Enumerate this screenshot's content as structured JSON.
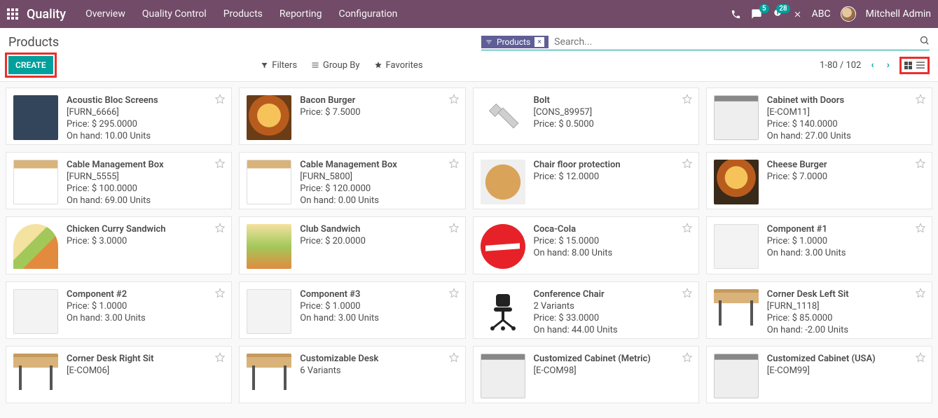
{
  "header": {
    "brand": "Quality",
    "nav": [
      "Overview",
      "Quality Control",
      "Products",
      "Reporting",
      "Configuration"
    ],
    "chat_badge": "5",
    "activity_badge": "28",
    "company": "ABC",
    "user": "Mitchell Admin"
  },
  "breadcrumb": "Products",
  "search": {
    "chip_label": "Products",
    "placeholder": "Search..."
  },
  "buttons": {
    "create": "CREATE"
  },
  "filters": {
    "filters": "Filters",
    "groupby": "Group By",
    "favorites": "Favorites"
  },
  "pager": {
    "range": "1-80 / 102"
  },
  "labels": {
    "price_prefix": "Price: $ ",
    "onhand_prefix": "On hand: ",
    "onhand_suffix": " Units",
    "variants_suffix": " Variants"
  },
  "products": [
    {
      "name": "Acoustic Bloc Screens",
      "ref": "[FURN_6666]",
      "price": "295.0000",
      "onhand": "10.00",
      "thumb": "t-screen"
    },
    {
      "name": "Bacon Burger",
      "price": "7.5000",
      "thumb": "t-burger"
    },
    {
      "name": "Bolt",
      "ref": "[CONS_89957]",
      "price": "0.5000",
      "thumb": "t-bolt"
    },
    {
      "name": "Cabinet with Doors",
      "ref": "[E-COM11]",
      "price": "140.0000",
      "onhand": "27.00",
      "thumb": "t-cabinet"
    },
    {
      "name": "Cable Management Box",
      "ref": "[FURN_5555]",
      "price": "100.0000",
      "onhand": "69.00",
      "thumb": "t-box"
    },
    {
      "name": "Cable Management Box",
      "ref": "[FURN_5800]",
      "price": "120.0000",
      "onhand": "0.00",
      "thumb": "t-box"
    },
    {
      "name": "Chair floor protection",
      "price": "12.0000",
      "thumb": "t-chairmat"
    },
    {
      "name": "Cheese Burger",
      "price": "7.0000",
      "thumb": "t-cheese"
    },
    {
      "name": "Chicken Curry Sandwich",
      "price": "3.0000",
      "thumb": "t-sandwich"
    },
    {
      "name": "Club Sandwich",
      "price": "20.0000",
      "thumb": "t-club"
    },
    {
      "name": "Coca-Cola",
      "price": "15.0000",
      "onhand": "8.00",
      "thumb": "t-coke"
    },
    {
      "name": "Component #1",
      "price": "1.0000",
      "onhand": "3.00",
      "thumb": "t-comp"
    },
    {
      "name": "Component #2",
      "price": "1.0000",
      "onhand": "3.00",
      "thumb": "t-comp"
    },
    {
      "name": "Component #3",
      "price": "1.0000",
      "onhand": "3.00",
      "thumb": "t-comp"
    },
    {
      "name": "Conference Chair",
      "variants": "2",
      "price": "33.0000",
      "onhand": "44.00",
      "thumb": "t-chair"
    },
    {
      "name": "Corner Desk Left Sit",
      "ref": "[FURN_1118]",
      "price": "85.0000",
      "onhand": "-2.00",
      "thumb": "t-desk"
    },
    {
      "name": "Corner Desk Right Sit",
      "ref": "[E-COM06]",
      "thumb": "t-desk"
    },
    {
      "name": "Customizable Desk",
      "variants": "6",
      "thumb": "t-desk"
    },
    {
      "name": "Customized Cabinet (Metric)",
      "ref": "[E-COM98]",
      "thumb": "t-cabinet"
    },
    {
      "name": "Customized Cabinet (USA)",
      "ref": "[E-COM99]",
      "thumb": "t-cabinet"
    }
  ]
}
